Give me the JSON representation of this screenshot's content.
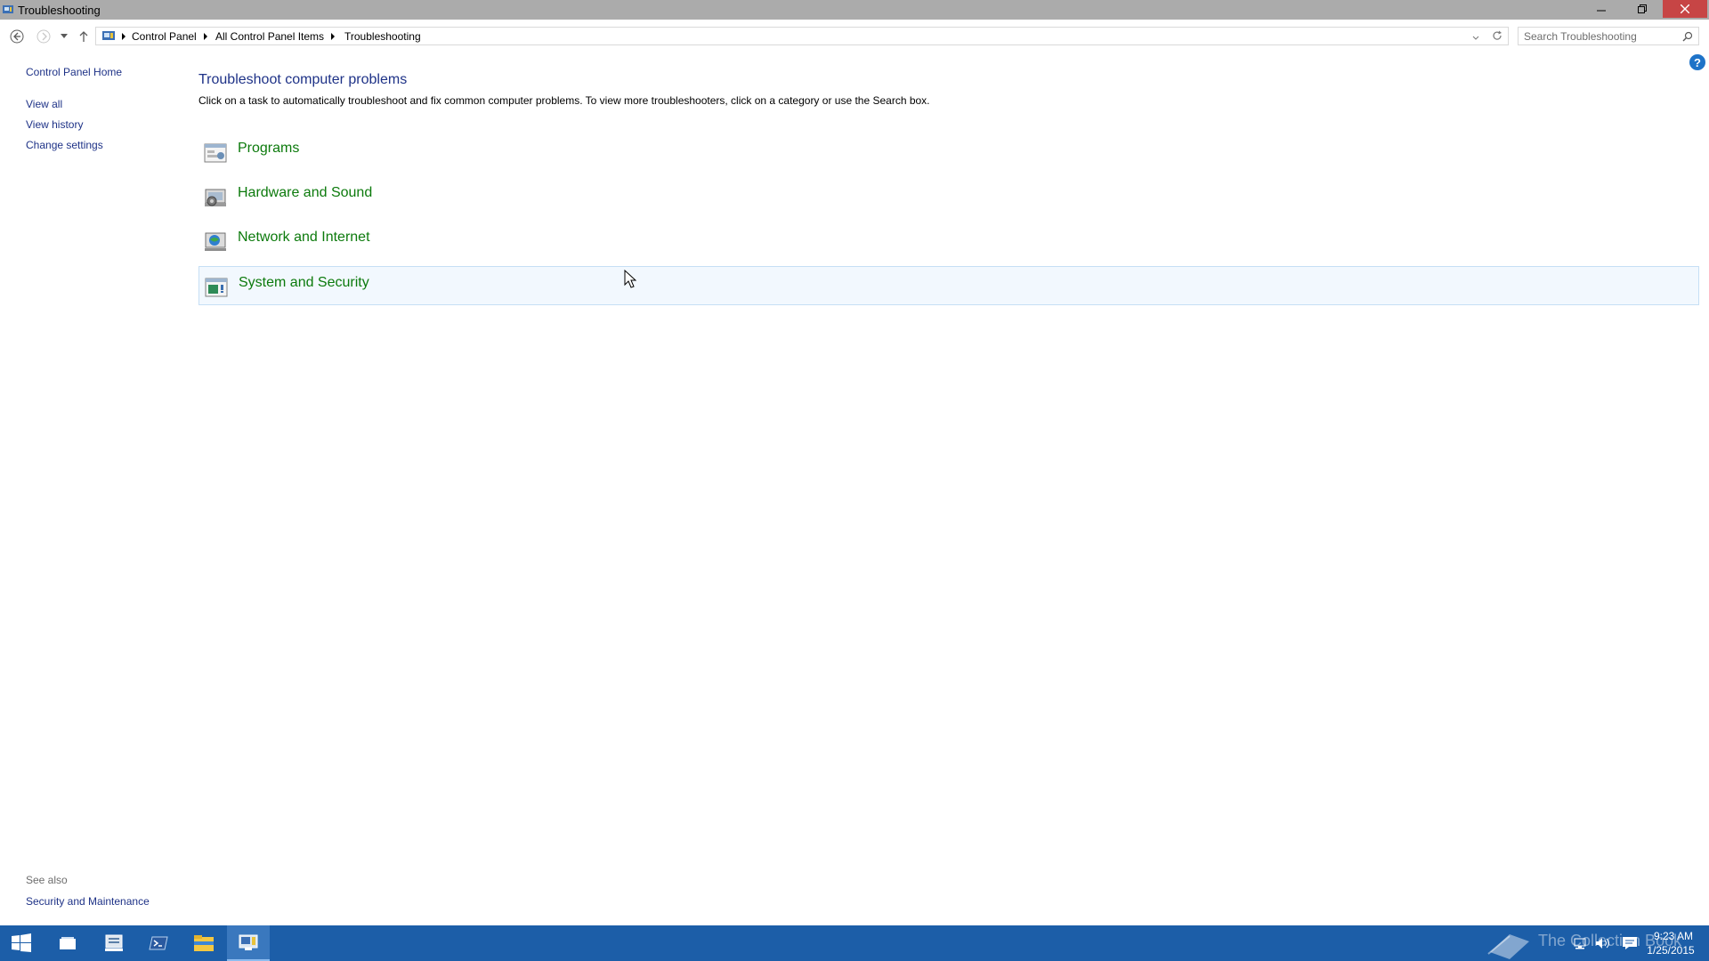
{
  "window": {
    "title": "Troubleshooting"
  },
  "breadcrumb": [
    "Control Panel",
    "All Control Panel Items",
    "Troubleshooting"
  ],
  "search": {
    "placeholder": "Search Troubleshooting"
  },
  "left_pane": {
    "home": "Control Panel Home",
    "links": [
      "View all",
      "View history",
      "Change settings"
    ],
    "see_also_label": "See also",
    "see_also_links": [
      "Security and Maintenance"
    ]
  },
  "main": {
    "title": "Troubleshoot computer problems",
    "description": "Click on a task to automatically troubleshoot and fix common computer problems. To view more troubleshooters, click on a category or use the Search box.",
    "categories": [
      {
        "label": "Programs",
        "icon": "programs-icon"
      },
      {
        "label": "Hardware and Sound",
        "icon": "hardware-sound-icon"
      },
      {
        "label": "Network and Internet",
        "icon": "network-internet-icon"
      },
      {
        "label": "System and Security",
        "icon": "system-security-icon"
      }
    ]
  },
  "help": {
    "glyph": "?"
  },
  "taskbar": {
    "time": "9:23 AM",
    "date": "1/25/2015",
    "watermark": "The Collection Book"
  },
  "colors": {
    "link": "#1e3287",
    "category": "#0c7a0c",
    "taskbar": "#1c5ea8",
    "titlebar": "#ababab"
  }
}
